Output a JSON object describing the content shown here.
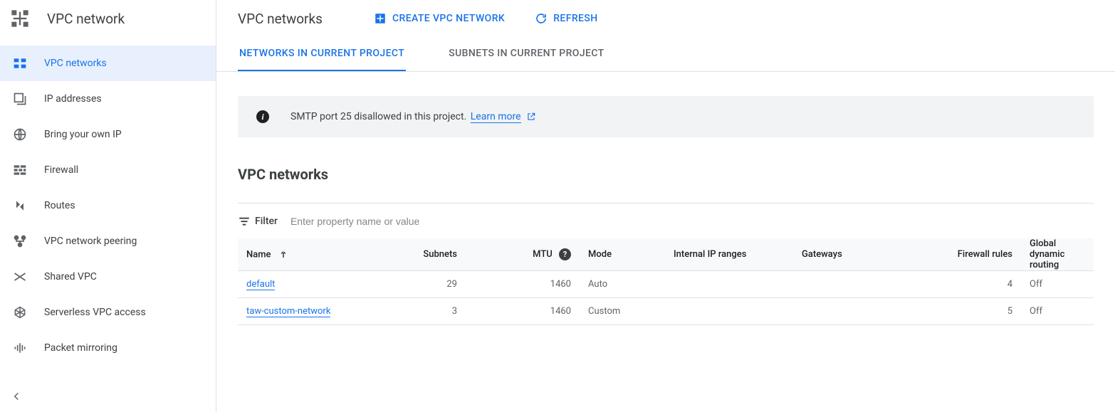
{
  "sidebar": {
    "title": "VPC network",
    "items": [
      {
        "label": "VPC networks",
        "active": true
      },
      {
        "label": "IP addresses",
        "active": false
      },
      {
        "label": "Bring your own IP",
        "active": false
      },
      {
        "label": "Firewall",
        "active": false
      },
      {
        "label": "Routes",
        "active": false
      },
      {
        "label": "VPC network peering",
        "active": false
      },
      {
        "label": "Shared VPC",
        "active": false
      },
      {
        "label": "Serverless VPC access",
        "active": false
      },
      {
        "label": "Packet mirroring",
        "active": false
      }
    ]
  },
  "header": {
    "title": "VPC networks",
    "create_label": "CREATE VPC NETWORK",
    "refresh_label": "REFRESH"
  },
  "tabs": [
    {
      "label": "NETWORKS IN CURRENT PROJECT",
      "active": true
    },
    {
      "label": "SUBNETS IN CURRENT PROJECT",
      "active": false
    }
  ],
  "banner": {
    "message": "SMTP port 25 disallowed in this project.",
    "link_text": "Learn more"
  },
  "section_title": "VPC networks",
  "filter": {
    "label": "Filter",
    "placeholder": "Enter property name or value"
  },
  "table": {
    "columns": {
      "name": "Name",
      "subnets": "Subnets",
      "mtu": "MTU",
      "mode": "Mode",
      "internal_ip": "Internal IP ranges",
      "gateways": "Gateways",
      "firewall": "Firewall rules",
      "routing": "Global dynamic routing"
    },
    "rows": [
      {
        "name": "default",
        "subnets": "29",
        "mtu": "1460",
        "mode": "Auto",
        "internal_ip": "",
        "gateways": "",
        "firewall": "4",
        "routing": "Off"
      },
      {
        "name": "taw-custom-network",
        "subnets": "3",
        "mtu": "1460",
        "mode": "Custom",
        "internal_ip": "",
        "gateways": "",
        "firewall": "5",
        "routing": "Off"
      }
    ]
  }
}
